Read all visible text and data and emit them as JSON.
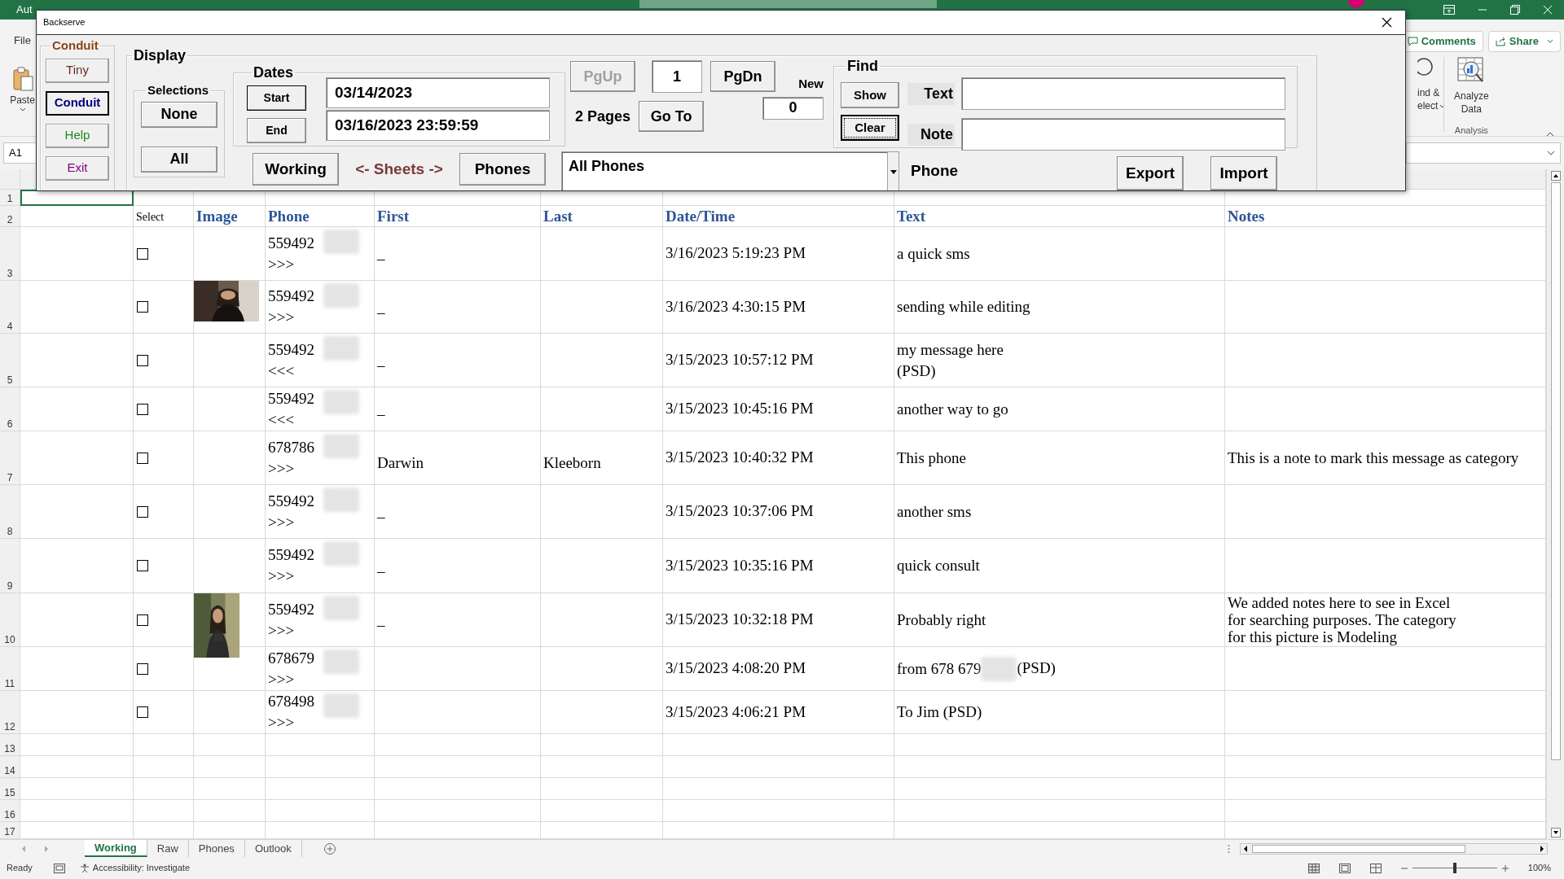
{
  "excel": {
    "title_fragment": "Aut",
    "file_tab": "File",
    "paste": "Paste",
    "comments": "Comments",
    "share": "Share",
    "find_select": [
      "ind &",
      "elect"
    ],
    "analyze": [
      "Analyze",
      "Data"
    ],
    "analysis_group": "Analysis",
    "name_box": "A1"
  },
  "dialog": {
    "title": "Backserve",
    "conduit": {
      "legend": "Conduit",
      "buttons": [
        {
          "label": "Tiny",
          "color": "#6b2a22",
          "selected": false
        },
        {
          "label": "Conduit",
          "color": "#000080",
          "selected": true
        },
        {
          "label": "Help",
          "color": "#1a8a1a",
          "selected": false
        },
        {
          "label": "Exit",
          "color": "#800080",
          "selected": false
        }
      ]
    },
    "display": {
      "legend": "Display",
      "selections": {
        "legend": "Selections",
        "buttons": [
          "None",
          "All"
        ]
      },
      "dates": {
        "legend": "Dates",
        "start_button": "Start",
        "end_button": "End",
        "start": "03/14/2023",
        "end": "03/16/2023 23:59:59"
      },
      "sheets": {
        "left": "Working",
        "label": "<- Sheets ->",
        "right": "Phones"
      },
      "paging": {
        "pgup": {
          "label": "PgUp",
          "disabled": true
        },
        "page": "1",
        "pgdn": "PgDn",
        "pages": "2 Pages",
        "goto": "Go To",
        "new_label": "New",
        "new_count": "0"
      },
      "phone_filter": "All Phones",
      "find": {
        "legend": "Find",
        "show": "Show",
        "clear": {
          "label": "Clear",
          "focused": true
        },
        "text_label": "Text",
        "note_label": "Note"
      },
      "phone_label": "Phone",
      "export": "Export",
      "import": "Import"
    }
  },
  "sheet": {
    "row_numbers": [
      "1",
      "2",
      "3",
      "4",
      "5",
      "6",
      "7",
      "8",
      "9",
      "10",
      "11",
      "12",
      "13",
      "14",
      "15",
      "16",
      "17"
    ],
    "columns": [
      "Select",
      "Image",
      "Phone",
      "First",
      "Last",
      "Date/Time",
      "Text",
      "Notes"
    ],
    "rows": [
      {
        "checked": false,
        "phone": "559492",
        "direction": ">>>",
        "first": "–",
        "datetime": "3/16/2023 5:19:23 PM",
        "text": "a quick sms"
      },
      {
        "checked": false,
        "phone": "559492",
        "direction": ">>>",
        "first": "–",
        "datetime": "3/16/2023 4:30:15 PM",
        "text": "sending while editing"
      },
      {
        "checked": false,
        "phone": "559492",
        "direction": "<<<",
        "first": "–",
        "datetime": "3/15/2023 10:57:12 PM",
        "text": "my message here\n(PSD)"
      },
      {
        "checked": false,
        "phone": "559492",
        "direction": "<<<",
        "first": "–",
        "datetime": "3/15/2023 10:45:16 PM",
        "text": "another way to go"
      },
      {
        "checked": false,
        "phone": "678786",
        "direction": ">>>",
        "first": "Darwin",
        "last": "Kleeborn",
        "datetime": "3/15/2023 10:40:32 PM",
        "text": "This phone",
        "notes": "This is a note to mark this message as category"
      },
      {
        "checked": false,
        "phone": "559492",
        "direction": ">>>",
        "first": "–",
        "datetime": "3/15/2023 10:37:06 PM",
        "text": "another sms"
      },
      {
        "checked": false,
        "phone": "559492",
        "direction": ">>>",
        "first": "–",
        "datetime": "3/15/2023 10:35:16 PM",
        "text": "quick consult"
      },
      {
        "checked": false,
        "phone": "559492",
        "direction": ">>>",
        "first": "–",
        "datetime": "3/15/2023 10:32:18 PM",
        "text": "Probably right",
        "notes": "We added notes here to see in Excel\nfor searching purposes. The category\nfor this picture is Modeling"
      },
      {
        "checked": false,
        "phone": "678679",
        "direction": ">>>",
        "datetime": "3/15/2023 4:08:20 PM",
        "text": "from 678 679",
        "text_redacted": true,
        "text_suffix": "(PSD)"
      },
      {
        "checked": false,
        "phone": "678498",
        "direction": ">>>",
        "datetime": "3/15/2023 4:06:21 PM",
        "text": "To Jim (PSD)"
      }
    ]
  },
  "sheet_tabs": [
    {
      "label": "Working",
      "selected": true
    },
    {
      "label": "Raw",
      "selected": false
    },
    {
      "label": "Phones",
      "selected": false
    },
    {
      "label": "Outlook",
      "selected": false
    }
  ],
  "status_bar": {
    "ready": "Ready",
    "accessibility": "Accessibility: Investigate",
    "zoom": "100%",
    "zoom_slider": {
      "level": 0.5
    }
  }
}
